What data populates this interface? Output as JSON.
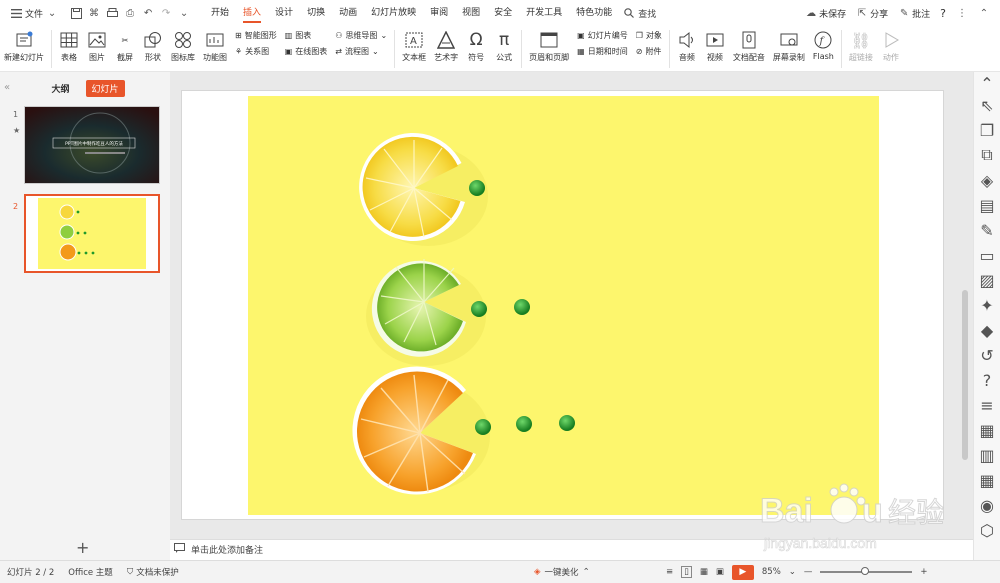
{
  "menubar": {
    "file_label": "文件",
    "tabs": [
      {
        "label": "开始",
        "active": false
      },
      {
        "label": "插入",
        "active": true
      },
      {
        "label": "设计",
        "active": false
      },
      {
        "label": "切换",
        "active": false
      },
      {
        "label": "动画",
        "active": false
      },
      {
        "label": "幻灯片放映",
        "active": false
      },
      {
        "label": "审阅",
        "active": false
      },
      {
        "label": "视图",
        "active": false
      },
      {
        "label": "安全",
        "active": false
      },
      {
        "label": "开发工具",
        "active": false
      },
      {
        "label": "特色功能",
        "active": false
      }
    ],
    "search_label": "查找",
    "unsaved_label": "未保存",
    "share_label": "分享",
    "comment_label": "批注",
    "help_label": "?"
  },
  "ribbon": {
    "new_slide": "新建幻灯片",
    "table": "表格",
    "picture": "图片",
    "screenshot": "截屏",
    "shape": "形状",
    "icon_library": "图标库",
    "function_chart": "功能图",
    "smart_art": "智能图形",
    "chart": "图表",
    "mind_map": "思维导图",
    "relation_chart": "关系图",
    "online_chart": "在线图表",
    "flow_chart": "流程图",
    "text_box": "文本框",
    "word_art": "艺术字",
    "symbol": "符号",
    "formula": "公式",
    "header_footer": "页眉和页脚",
    "slide_number": "幻灯片编号",
    "object": "对象",
    "date_time": "日期和时间",
    "attachment": "附件",
    "audio": "音频",
    "video": "视频",
    "doc_voiceover": "文档配音",
    "screen_record": "屏幕录制",
    "flash": "Flash",
    "hyperlink": "超链接",
    "action": "动作"
  },
  "leftpane": {
    "outline_tab": "大纲",
    "slides_tab": "幻灯片",
    "slides": [
      {
        "number": "1",
        "title_text": "PPT图片中制作吃豆人的方法"
      },
      {
        "number": "2"
      }
    ]
  },
  "notes_placeholder": "单击此处添加备注",
  "status": {
    "slide_info": "幻灯片 2 / 2",
    "theme": "Office 主题",
    "protection": "文档未保护",
    "beautify": "一键美化",
    "zoom": "85%"
  },
  "colors": {
    "accent": "#e8552a",
    "slide_bg": "#fdf66d",
    "lemon": "#f7d73c",
    "lime": "#8fce3e",
    "orange": "#f39a1a",
    "pea": "#1f9a2a"
  },
  "watermark": {
    "brand": "Baidu",
    "sub": "经验",
    "url": "jingyan.baidu.com"
  }
}
